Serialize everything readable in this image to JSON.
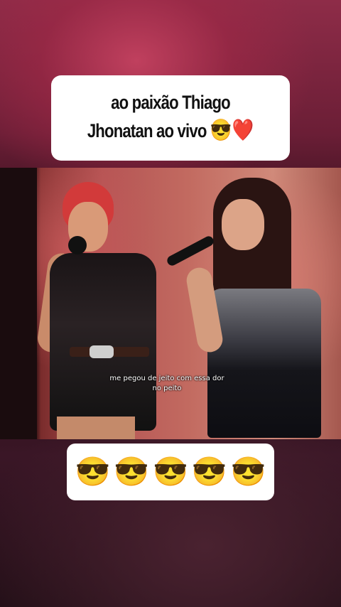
{
  "caption": {
    "line1": "ao paixão Thiago",
    "line2_text": "Jhonatan ao vivo",
    "line2_emojis": "😎❤️"
  },
  "video": {
    "subtitle": "me pegou de jeito com essa dor no peito"
  },
  "reaction": {
    "emojis": [
      "😎",
      "😎",
      "😎",
      "😎",
      "😎"
    ]
  }
}
